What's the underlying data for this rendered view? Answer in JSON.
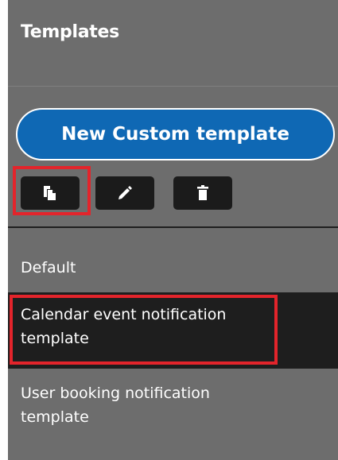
{
  "panel": {
    "title": "Templates",
    "new_button_label": "New Custom template"
  },
  "toolbar": {
    "copy_icon": "copy-icon",
    "edit_icon": "pencil-icon",
    "delete_icon": "trash-icon"
  },
  "templates": [
    {
      "label": "Default"
    },
    {
      "label": "Calendar event notification template",
      "selected": true
    },
    {
      "label": "User booking notification template"
    }
  ],
  "colors": {
    "panel_bg": "#6d6d6d",
    "primary_button": "#0f68b4",
    "toolbar_button": "#1b1b1b",
    "selected_row": "#1e1e1e",
    "highlight": "#e3242b"
  }
}
